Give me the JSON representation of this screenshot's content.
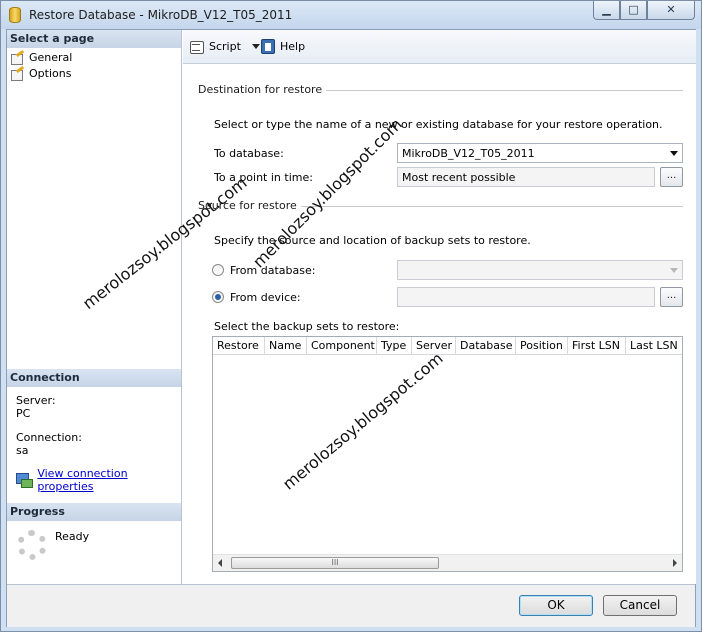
{
  "window": {
    "title": "Restore Database - MikroDB_V12_T05_2011",
    "controls": [
      "minimize-icon",
      "maximize-icon",
      "close-icon"
    ]
  },
  "left": {
    "select_page": "Select a page",
    "pages": [
      "General",
      "Options"
    ],
    "connection_header": "Connection",
    "server_label": "Server:",
    "server_value": "PC",
    "connection_label": "Connection:",
    "connection_value": "sa",
    "view_link": "View connection properties",
    "progress_header": "Progress",
    "progress_status": "Ready"
  },
  "toolbar": {
    "script_label": "Script",
    "help_label": "Help"
  },
  "destination": {
    "title": "Destination for restore",
    "instruction": "Select or type the name of a new or existing database for your restore operation.",
    "to_database_label": "To database:",
    "to_database_value": "MikroDB_V12_T05_2011",
    "point_in_time_label": "To a point in time:",
    "point_in_time_value": "Most recent possible",
    "browse_label": "..."
  },
  "source": {
    "title": "Source for restore",
    "instruction": "Specify the source and location of backup sets to restore.",
    "from_database_label": "From database:",
    "from_database_value": "",
    "from_device_label": "From device:",
    "from_device_value": "",
    "selected_option": "From device",
    "browse_label": "...",
    "backup_sets_label": "Select the backup sets to restore:",
    "columns": [
      "Restore",
      "Name",
      "Component",
      "Type",
      "Server",
      "Database",
      "Position",
      "First LSN",
      "Last LSN"
    ],
    "scroll_grip": "III"
  },
  "footer": {
    "ok_label": "OK",
    "cancel_label": "Cancel"
  },
  "watermark": {
    "text": "merolozsoy.blogspot.com"
  }
}
